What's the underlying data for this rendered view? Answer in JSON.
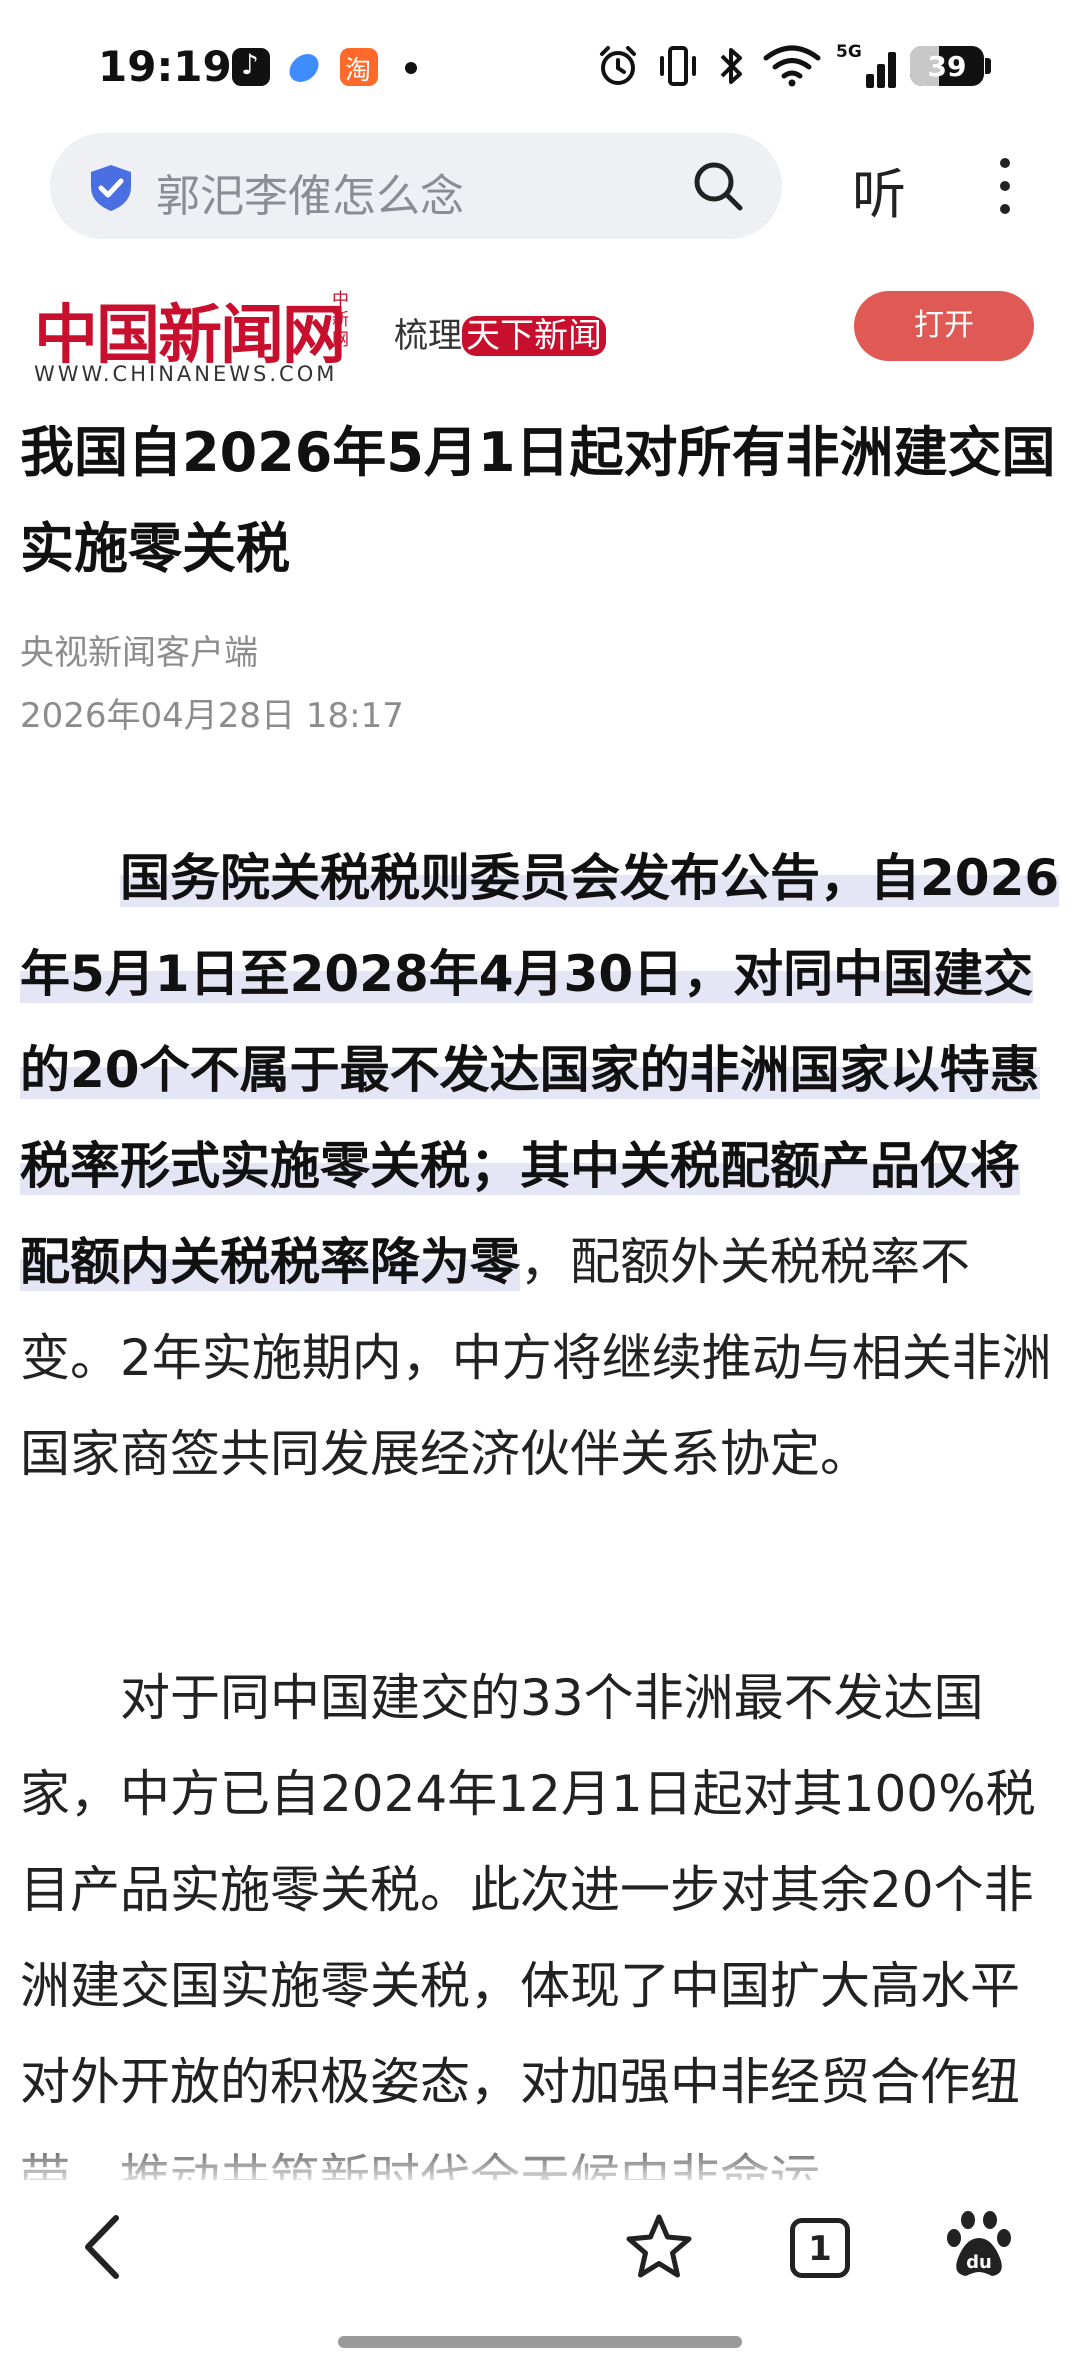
{
  "status_bar": {
    "time": "19:19",
    "notification_icons": [
      "tiktok-icon",
      "blue-app-icon",
      "taobao-icon",
      "dot-icon"
    ],
    "system_icons": [
      "alarm-icon",
      "vibrate-icon",
      "bluetooth-icon",
      "wifi-icon",
      "signal-5g-icon"
    ],
    "network": "5G",
    "battery": "39",
    "battery_level": 0.39
  },
  "search": {
    "query": "郭汜李傕怎么念",
    "listen_label": "听"
  },
  "site": {
    "logo_text": "中国新闻网",
    "logo_side": "中新网",
    "url": "WWW.CHINANEWS.COM",
    "slogan_a": "梳理",
    "slogan_b": "天下新闻",
    "open_label": "打开",
    "brand_color": "#c8102e"
  },
  "article": {
    "title": "我国自2026年5月1日起对所有非洲建交国实施零关税",
    "source": "央视新闻客户端",
    "date": "2026年04月28日 18:17",
    "p1_highlight": "国务院关税税则委员会发布公告，自2026年5月1日至2028年4月30日，对同中国建交的20个不属于最不发达国家的非洲国家以特惠税率形式实施零关税；其中关税配额产品仅将配额内关税税率降为零",
    "p1_rest": "，配额外关税税率不变。2年实施期内，中方将继续推动与相关非洲国家商签共同发展经济伙伴关系协定。",
    "p2": "对于同中国建交的33个非洲最不发达国家，中方已自2024年12月1日起对其100%税目产品实施零关税。此次进一步对其余20个非洲建交国实施零关税，体现了中国扩大高水平对外开放的积极姿态，对加强中非经贸合作纽带，推动共筑新时代全天候中非命运"
  },
  "bottom_nav": {
    "tabs_count": "1",
    "icons": [
      "back-icon",
      "star-icon",
      "tabs-icon",
      "baidu-paw-icon"
    ]
  }
}
